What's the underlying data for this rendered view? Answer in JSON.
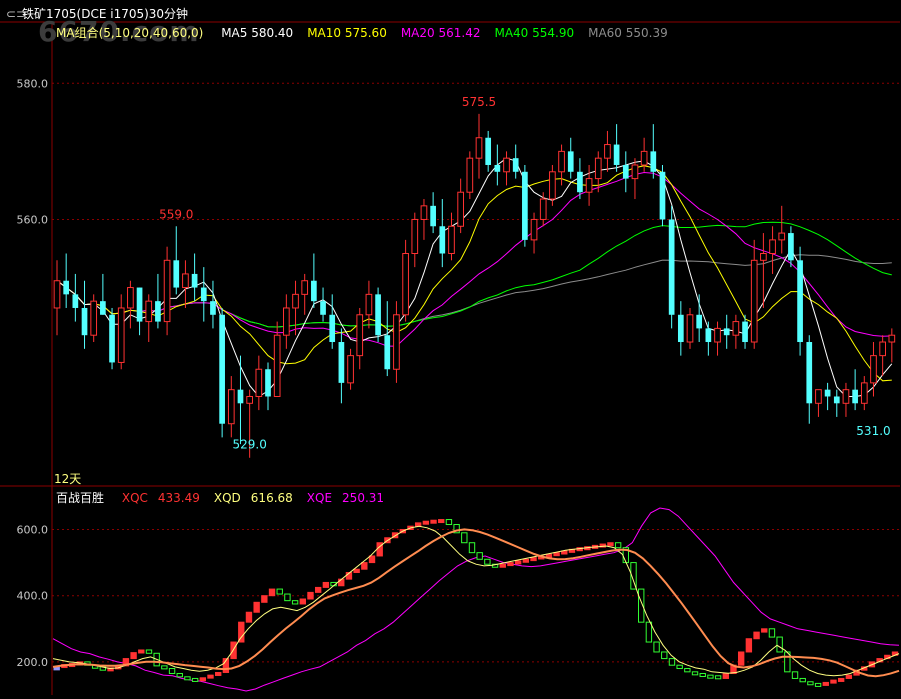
{
  "header": {
    "title": "铁矿1705(DCE i1705)30分钟",
    "watermark": "6670.com"
  },
  "colors": {
    "up": "#ff3232",
    "down": "#54ffff",
    "ma5": "#ffffff",
    "ma10": "#ffff00",
    "ma20": "#ff00ff",
    "ma40": "#00ff00",
    "ma60": "#8c8c8c",
    "xqc": "#ff3232",
    "xqd": "#ffff80",
    "xqe": "#ff00ff",
    "axis": "#8b0000"
  },
  "price_panel": {
    "legend_name": "MA组合(5,10,20,40,60,0)",
    "legend": [
      {
        "label": "MA5 580.40",
        "color": "#ffffff"
      },
      {
        "label": "MA10 575.60",
        "color": "#ffff00"
      },
      {
        "label": "MA20 561.42",
        "color": "#ff00ff"
      },
      {
        "label": "MA40 554.90",
        "color": "#00ff00"
      },
      {
        "label": "MA60 550.39",
        "color": "#8c8c8c"
      }
    ],
    "period_label": "12天"
  },
  "indicator_panel": {
    "name": "百战百胜",
    "legend": [
      {
        "label": "XQC",
        "value": "433.49",
        "color": "#ff3232"
      },
      {
        "label": "XQD",
        "value": "616.68",
        "color": "#ffff80"
      },
      {
        "label": "XQE",
        "value": "250.31",
        "color": "#ff00ff"
      }
    ]
  },
  "chart_data": [
    {
      "type": "candlestick",
      "title": "铁矿1705(DCE i1705)30分钟",
      "ylim": [
        521,
        589
      ],
      "yticks": [
        560.0,
        580.0
      ],
      "grid": true,
      "annotations": [
        {
          "label": "575.5",
          "index": 46,
          "value": 575.5
        },
        {
          "label": "559.0",
          "index": 13,
          "value": 559.0
        },
        {
          "label": "529.0",
          "index": 21,
          "value": 529.0
        },
        {
          "label": "531.0",
          "index": 89,
          "value": 531.0
        }
      ],
      "candles": [
        {
          "o": 547,
          "h": 554,
          "l": 543,
          "c": 551
        },
        {
          "o": 551,
          "h": 555,
          "l": 547,
          "c": 549
        },
        {
          "o": 549,
          "h": 552,
          "l": 545,
          "c": 547
        },
        {
          "o": 547,
          "h": 551,
          "l": 541,
          "c": 543
        },
        {
          "o": 543,
          "h": 549,
          "l": 542,
          "c": 548
        },
        {
          "o": 548,
          "h": 552,
          "l": 546,
          "c": 546
        },
        {
          "o": 546,
          "h": 547,
          "l": 538,
          "c": 539
        },
        {
          "o": 539,
          "h": 549,
          "l": 538,
          "c": 547
        },
        {
          "o": 547,
          "h": 551,
          "l": 544,
          "c": 550
        },
        {
          "o": 550,
          "h": 550,
          "l": 543,
          "c": 545
        },
        {
          "o": 545,
          "h": 549,
          "l": 542,
          "c": 548
        },
        {
          "o": 548,
          "h": 552,
          "l": 544,
          "c": 545
        },
        {
          "o": 545,
          "h": 556,
          "l": 543,
          "c": 554
        },
        {
          "o": 554,
          "h": 559,
          "l": 549,
          "c": 550
        },
        {
          "o": 550,
          "h": 554,
          "l": 547,
          "c": 552
        },
        {
          "o": 552,
          "h": 555,
          "l": 548,
          "c": 550
        },
        {
          "o": 550,
          "h": 553,
          "l": 545,
          "c": 548
        },
        {
          "o": 548,
          "h": 551,
          "l": 544,
          "c": 546
        },
        {
          "o": 546,
          "h": 547,
          "l": 528,
          "c": 530
        },
        {
          "o": 530,
          "h": 537,
          "l": 528,
          "c": 535
        },
        {
          "o": 535,
          "h": 540,
          "l": 527,
          "c": 533
        },
        {
          "o": 533,
          "h": 535,
          "l": 525,
          "c": 534
        },
        {
          "o": 534,
          "h": 540,
          "l": 532,
          "c": 538
        },
        {
          "o": 538,
          "h": 539,
          "l": 532,
          "c": 534
        },
        {
          "o": 534,
          "h": 545,
          "l": 534,
          "c": 543
        },
        {
          "o": 543,
          "h": 549,
          "l": 541,
          "c": 547
        },
        {
          "o": 547,
          "h": 551,
          "l": 543,
          "c": 549
        },
        {
          "o": 549,
          "h": 552,
          "l": 546,
          "c": 551
        },
        {
          "o": 551,
          "h": 555,
          "l": 547,
          "c": 548
        },
        {
          "o": 548,
          "h": 550,
          "l": 545,
          "c": 546
        },
        {
          "o": 546,
          "h": 549,
          "l": 541,
          "c": 542
        },
        {
          "o": 542,
          "h": 544,
          "l": 533,
          "c": 536
        },
        {
          "o": 536,
          "h": 541,
          "l": 535,
          "c": 540
        },
        {
          "o": 540,
          "h": 547,
          "l": 538,
          "c": 546
        },
        {
          "o": 546,
          "h": 551,
          "l": 544,
          "c": 549
        },
        {
          "o": 549,
          "h": 550,
          "l": 542,
          "c": 543
        },
        {
          "o": 543,
          "h": 548,
          "l": 537,
          "c": 538
        },
        {
          "o": 538,
          "h": 548,
          "l": 536,
          "c": 546
        },
        {
          "o": 546,
          "h": 557,
          "l": 545,
          "c": 555
        },
        {
          "o": 555,
          "h": 561,
          "l": 553,
          "c": 560
        },
        {
          "o": 560,
          "h": 563,
          "l": 557,
          "c": 562
        },
        {
          "o": 562,
          "h": 564,
          "l": 558,
          "c": 559
        },
        {
          "o": 559,
          "h": 563,
          "l": 553,
          "c": 555
        },
        {
          "o": 555,
          "h": 561,
          "l": 554,
          "c": 559
        },
        {
          "o": 559,
          "h": 566,
          "l": 558,
          "c": 564
        },
        {
          "o": 564,
          "h": 570,
          "l": 563,
          "c": 569
        },
        {
          "o": 569,
          "h": 575.5,
          "l": 566,
          "c": 572
        },
        {
          "o": 572,
          "h": 573,
          "l": 567,
          "c": 568
        },
        {
          "o": 568,
          "h": 571,
          "l": 565,
          "c": 567
        },
        {
          "o": 567,
          "h": 570,
          "l": 565,
          "c": 569
        },
        {
          "o": 569,
          "h": 571,
          "l": 566,
          "c": 567
        },
        {
          "o": 567,
          "h": 568,
          "l": 556,
          "c": 557
        },
        {
          "o": 557,
          "h": 561,
          "l": 555,
          "c": 560
        },
        {
          "o": 560,
          "h": 564,
          "l": 559,
          "c": 563
        },
        {
          "o": 563,
          "h": 568,
          "l": 562,
          "c": 567
        },
        {
          "o": 567,
          "h": 571,
          "l": 565,
          "c": 570
        },
        {
          "o": 570,
          "h": 572,
          "l": 566,
          "c": 567
        },
        {
          "o": 567,
          "h": 569,
          "l": 563,
          "c": 564
        },
        {
          "o": 564,
          "h": 568,
          "l": 562,
          "c": 566
        },
        {
          "o": 566,
          "h": 570,
          "l": 564,
          "c": 569
        },
        {
          "o": 569,
          "h": 573,
          "l": 567,
          "c": 571
        },
        {
          "o": 571,
          "h": 574,
          "l": 567,
          "c": 568
        },
        {
          "o": 568,
          "h": 570,
          "l": 564,
          "c": 566
        },
        {
          "o": 566,
          "h": 569,
          "l": 563,
          "c": 568
        },
        {
          "o": 568,
          "h": 572,
          "l": 567,
          "c": 570
        },
        {
          "o": 570,
          "h": 574,
          "l": 566,
          "c": 567
        },
        {
          "o": 567,
          "h": 568,
          "l": 559,
          "c": 560
        },
        {
          "o": 560,
          "h": 562,
          "l": 544,
          "c": 546
        },
        {
          "o": 546,
          "h": 548,
          "l": 540,
          "c": 542
        },
        {
          "o": 542,
          "h": 547,
          "l": 541,
          "c": 546
        },
        {
          "o": 546,
          "h": 549,
          "l": 542,
          "c": 544
        },
        {
          "o": 544,
          "h": 545,
          "l": 540,
          "c": 542
        },
        {
          "o": 542,
          "h": 545,
          "l": 540,
          "c": 544
        },
        {
          "o": 544,
          "h": 546,
          "l": 541,
          "c": 543
        },
        {
          "o": 543,
          "h": 546,
          "l": 541,
          "c": 545
        },
        {
          "o": 545,
          "h": 546,
          "l": 541,
          "c": 542
        },
        {
          "o": 542,
          "h": 557,
          "l": 541,
          "c": 554
        },
        {
          "o": 554,
          "h": 558,
          "l": 547,
          "c": 555
        },
        {
          "o": 555,
          "h": 559,
          "l": 552,
          "c": 557
        },
        {
          "o": 557,
          "h": 562,
          "l": 555,
          "c": 558
        },
        {
          "o": 558,
          "h": 559,
          "l": 553,
          "c": 554
        },
        {
          "o": 554,
          "h": 556,
          "l": 540,
          "c": 542
        },
        {
          "o": 542,
          "h": 543,
          "l": 530,
          "c": 533
        },
        {
          "o": 533,
          "h": 535,
          "l": 531,
          "c": 535
        },
        {
          "o": 535,
          "h": 536,
          "l": 532,
          "c": 534
        },
        {
          "o": 534,
          "h": 535,
          "l": 531,
          "c": 533
        },
        {
          "o": 533,
          "h": 536,
          "l": 531,
          "c": 535
        },
        {
          "o": 535,
          "h": 538,
          "l": 532,
          "c": 533
        },
        {
          "o": 533,
          "h": 537,
          "l": 532,
          "c": 536
        },
        {
          "o": 536,
          "h": 542,
          "l": 534,
          "c": 540
        },
        {
          "o": 540,
          "h": 543,
          "l": 537,
          "c": 542
        },
        {
          "o": 542,
          "h": 544,
          "l": 539,
          "c": 543
        }
      ]
    },
    {
      "type": "bar",
      "title": "百战百胜",
      "ylim": [
        100,
        680
      ],
      "yticks": [
        200.0,
        400.0,
        600.0
      ],
      "grid": true,
      "series": [
        {
          "name": "XQC",
          "values": [
            185,
            192,
            195,
            200,
            190,
            186,
            175,
            182,
            188,
            210,
            228,
            236,
            226,
            188,
            180,
            165,
            155,
            150,
            148,
            152,
            160,
            168,
            210,
            260,
            320,
            350,
            380,
            400,
            420,
            405,
            385,
            375,
            390,
            410,
            425,
            440,
            430,
            450,
            470,
            480,
            500,
            520,
            560,
            575,
            590,
            600,
            610,
            620,
            625,
            628,
            630,
            615,
            590,
            560,
            530,
            510,
            495,
            488,
            495,
            500,
            505,
            510,
            515,
            520,
            525,
            530,
            535,
            540,
            545,
            548,
            552,
            556,
            560,
            545,
            500,
            420,
            320,
            260,
            230,
            210,
            190,
            180,
            170,
            165,
            160,
            158,
            150,
            165,
            190,
            230,
            270,
            290,
            300,
            275,
            230,
            170,
            150,
            140,
            135,
            130,
            138,
            145,
            150,
            160,
            175,
            185,
            200,
            210,
            220,
            230
          ]
        },
        {
          "name": "XQD",
          "values": [
            210,
            205,
            200,
            198,
            195,
            190,
            185,
            180,
            182,
            190,
            200,
            210,
            215,
            205,
            195,
            185,
            180,
            175,
            172,
            175,
            182,
            195,
            230,
            270,
            300,
            325,
            345,
            360,
            365,
            360,
            355,
            365,
            380,
            400,
            420,
            440,
            460,
            480,
            500,
            520,
            545,
            565,
            580,
            595,
            605,
            610,
            605,
            595,
            575,
            550,
            525,
            505,
            495,
            490,
            492,
            497,
            502,
            507,
            512,
            517,
            522,
            527,
            532,
            537,
            540,
            543,
            546,
            548,
            550,
            545,
            525,
            470,
            400,
            340,
            290,
            250,
            220,
            200,
            190,
            182,
            178,
            170,
            168,
            166,
            168,
            175,
            185,
            205,
            230,
            250,
            235,
            210,
            190,
            175,
            165,
            160,
            158,
            160,
            165,
            175,
            185,
            195,
            205,
            215,
            225
          ]
        },
        {
          "name": "XQE",
          "values": [
            270,
            255,
            240,
            230,
            225,
            215,
            208,
            200,
            195,
            188,
            175,
            168,
            160,
            158,
            150,
            145,
            142,
            135,
            128,
            122,
            118,
            112,
            118,
            130,
            140,
            150,
            160,
            170,
            178,
            185,
            200,
            215,
            230,
            250,
            265,
            285,
            300,
            320,
            345,
            370,
            395,
            420,
            445,
            468,
            490,
            505,
            515,
            520,
            510,
            500,
            495,
            490,
            488,
            490,
            495,
            500,
            505,
            510,
            515,
            520,
            525,
            530,
            540,
            560,
            610,
            650,
            665,
            660,
            640,
            610,
            580,
            550,
            520,
            480,
            440,
            410,
            380,
            350,
            330,
            320,
            310,
            300,
            295,
            290,
            285,
            280,
            275,
            270,
            265,
            260,
            255,
            252,
            250
          ]
        }
      ]
    }
  ]
}
